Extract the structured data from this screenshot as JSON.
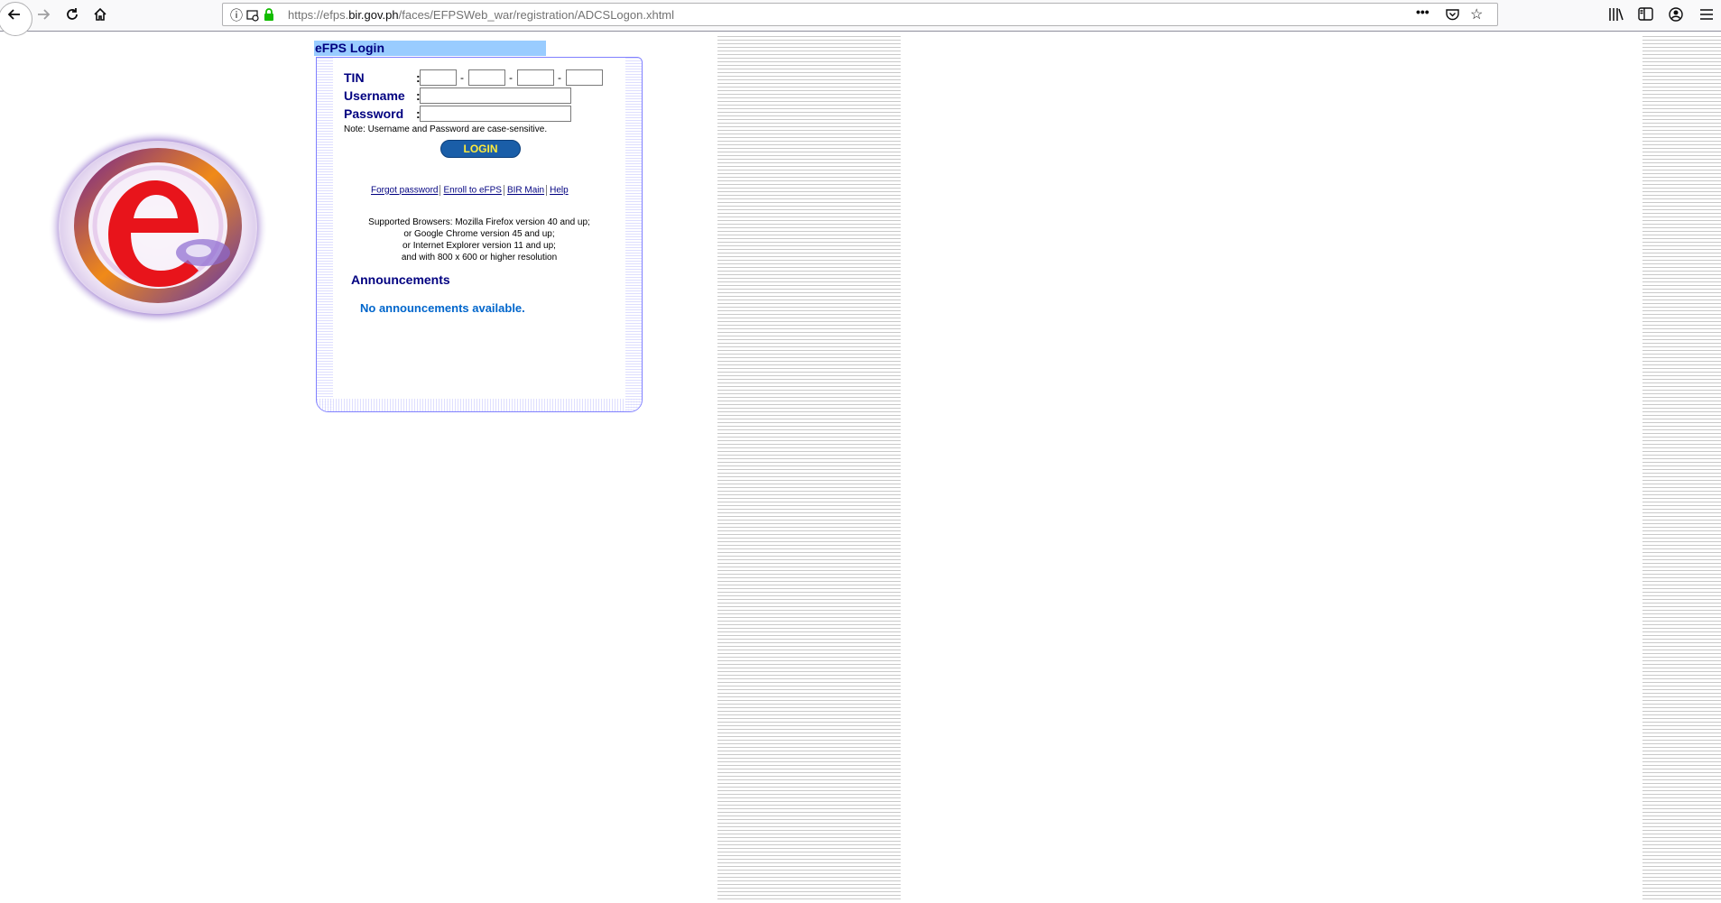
{
  "browser": {
    "url_prefix": "https://efps.",
    "url_domain": "bir.gov.ph",
    "url_path": "/faces/EFPSWeb_war/registration/ADCSLogon.xhtml",
    "icons": {
      "back": "back-arrow-icon",
      "forward": "forward-arrow-icon",
      "reload": "reload-icon",
      "home": "home-icon",
      "info": "info-icon",
      "lock": "lock-icon",
      "more": "more-icon",
      "pocket": "pocket-icon",
      "bookmark": "bookmark-star-icon",
      "library": "library-icon",
      "sidebar": "sidebar-icon",
      "account": "account-icon",
      "menu": "hamburger-menu-icon"
    }
  },
  "login": {
    "header": "eFPS Login",
    "tin_label": "TIN",
    "username_label": "Username",
    "password_label": "Password",
    "colon": ":",
    "dash": "-",
    "tin_values": [
      "",
      "",
      "",
      ""
    ],
    "username_value": "",
    "password_value": "",
    "note": "Note: Username and Password are case-sensitive.",
    "login_button": "LOGIN",
    "links": {
      "forgot": "Forgot password",
      "enroll": "Enroll to eFPS",
      "bir_main": "BIR Main",
      "help": "Help"
    },
    "browsers": [
      "Supported Browsers: Mozilla Firefox version 40 and up;",
      "or Google Chrome version 45 and up;",
      "or Internet Explorer version 11 and up;",
      "and with 800 x 600 or higher resolution"
    ],
    "announcements_title": "Announcements",
    "announcements_empty": "No announcements available."
  },
  "colors": {
    "header_bg": "#99ccff",
    "label": "#000080",
    "button_bg": "#1a5ea8",
    "button_text": "#ffeb3b",
    "announcement": "#0066cc"
  }
}
